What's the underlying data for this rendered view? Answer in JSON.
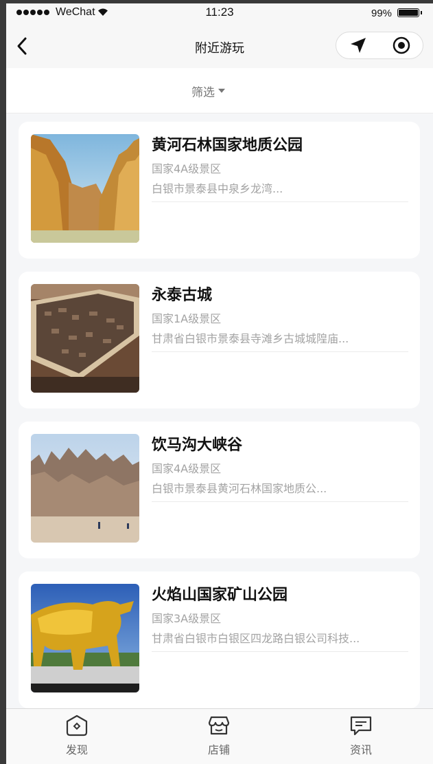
{
  "status_bar": {
    "carrier": "WeChat",
    "time": "11:23",
    "battery": "99%",
    "battery_level": 0.99
  },
  "nav": {
    "title": "附近游玩"
  },
  "filter": {
    "label": "筛选"
  },
  "places": [
    {
      "name": "黄河石林国家地质公园",
      "level": "国家4A级景区",
      "address": "白银市景泰县中泉乡龙湾..."
    },
    {
      "name": "永泰古城",
      "level": "国家1A级景区",
      "address": "甘肃省白银市景泰县寺滩乡古城城隍庙..."
    },
    {
      "name": "饮马沟大峡谷",
      "level": "国家4A级景区",
      "address": "白银市景泰县黄河石林国家地质公..."
    },
    {
      "name": "火焰山国家矿山公园",
      "level": "国家3A级景区",
      "address": "甘肃省白银市白银区四龙路白银公司科技..."
    }
  ],
  "tabbar": {
    "items": [
      {
        "label": "发现"
      },
      {
        "label": "店铺"
      },
      {
        "label": "资讯"
      }
    ]
  },
  "colors": {
    "background": "#f5f6f8",
    "title": "#111111",
    "muted": "#a3a3a3"
  }
}
